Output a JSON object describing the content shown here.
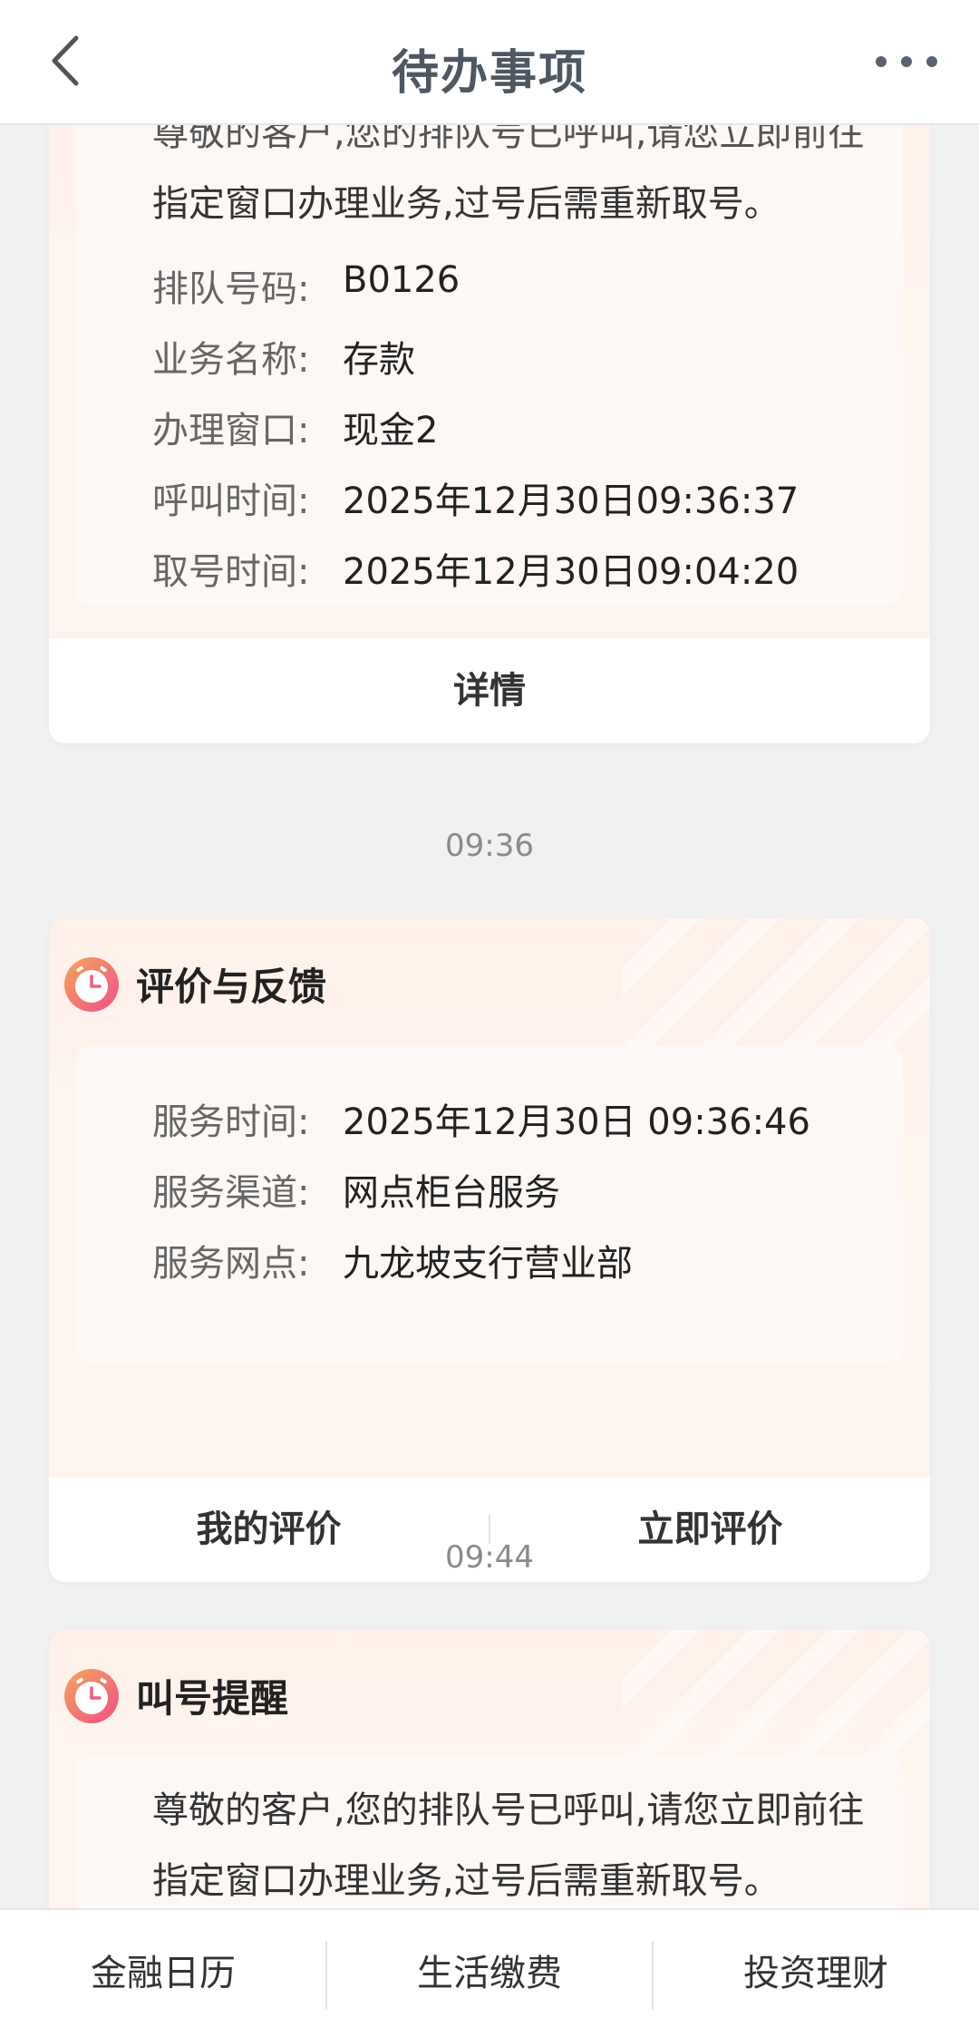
{
  "header": {
    "title": "待办事项"
  },
  "cards": [
    {
      "partial_top_text": "尊敬的客户,您的排队号已呼叫,请您立即前往",
      "message_line2": "指定窗口办理业务,过号后需重新取号。",
      "fields": [
        {
          "label": "排队号码:",
          "value": "B0126"
        },
        {
          "label": "业务名称:",
          "value": "存款"
        },
        {
          "label": "办理窗口:",
          "value": "现金2"
        },
        {
          "label": "呼叫时间:",
          "value": "2025年12月30日09:36:37"
        },
        {
          "label": "取号时间:",
          "value": "2025年12月30日09:04:20"
        }
      ],
      "action": "详情"
    },
    {
      "title": "评价与反馈",
      "fields": [
        {
          "label": "服务时间:",
          "value": "2025年12月30日 09:36:46"
        },
        {
          "label": "服务渠道:",
          "value": "网点柜台服务"
        },
        {
          "label": "服务网点:",
          "value": "九龙坡支行营业部"
        }
      ],
      "actions": [
        "我的评价",
        "立即评价"
      ]
    },
    {
      "title": "叫号提醒",
      "message_line1": "尊敬的客户,您的排队号已呼叫,请您立即前往",
      "message_line2": "指定窗口办理业务,过号后需重新取号。"
    }
  ],
  "timestamps": [
    "09:36",
    "09:44"
  ],
  "tabbar": [
    "金融日历",
    "生活缴费",
    "投资理财"
  ],
  "colors": {
    "title": "#4e5863",
    "card_bg": "#fff1ea",
    "clock_icon": "#f0677d"
  }
}
